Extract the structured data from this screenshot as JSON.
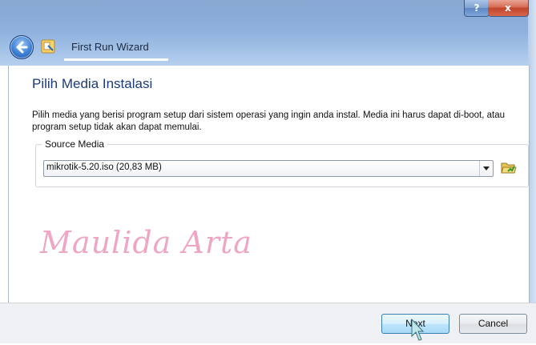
{
  "window": {
    "title": "First Run Wizard",
    "help_label": "?",
    "close_label": "x"
  },
  "page": {
    "heading": "Pilih Media Instalasi",
    "description": "Pilih media yang berisi program setup dari sistem operasi yang ingin anda instal. Media ini harus dapat di-boot, atau program setup tidak akan dapat memulai."
  },
  "source_media": {
    "legend": "Source Media",
    "selected": "mikrotik-5.20.iso (20,83 MB)"
  },
  "watermark": "Maulida Arta",
  "buttons": {
    "next": "Next",
    "cancel": "Cancel"
  },
  "icons": {
    "back": "back-arrow-icon",
    "wizard": "wizard-app-icon",
    "folder": "open-folder-icon",
    "dropdown": "chevron-down-icon",
    "cursor": "mouse-pointer-icon"
  },
  "colors": {
    "heading": "#1e3b78",
    "watermark": "#efa6c4",
    "close": "#c9553d"
  }
}
